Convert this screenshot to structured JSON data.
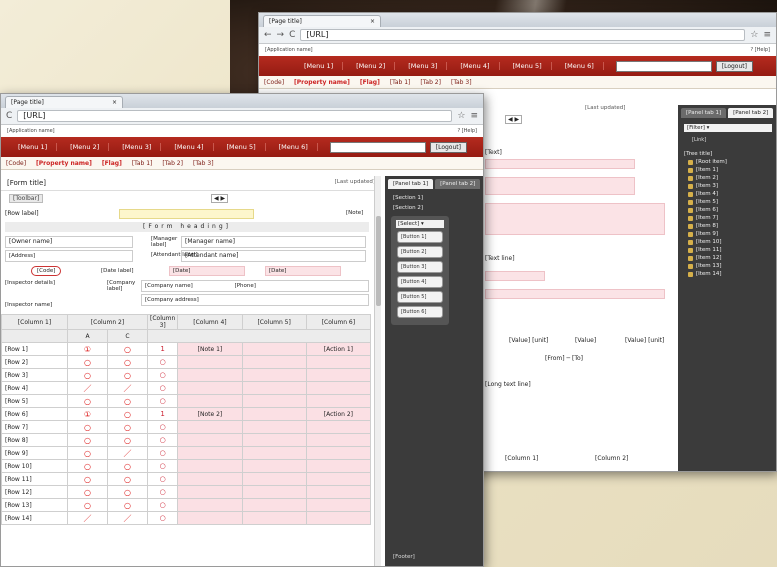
{
  "browser": {
    "tab_title": "[Page title]",
    "tab_close": "×",
    "url": "[URL]",
    "nav": {
      "back": "←",
      "forward": "→",
      "reload": "C"
    },
    "star": "☆",
    "menu": "≡"
  },
  "app": {
    "subtitle": "[Application name]",
    "help_label": "? [Help]",
    "menu_items": [
      "[Menu 1]",
      "[Menu 2]",
      "[Menu 3]",
      "[Menu 4]",
      "[Menu 5]",
      "[Menu 6]"
    ],
    "logout_label": "[Logout]",
    "property_code": "[Code]",
    "property_name": "[Property name]",
    "property_flag": "[Flag]",
    "prop_tabs": [
      "[Tab 1]",
      "[Tab 2]",
      "[Tab 3]"
    ]
  },
  "back_window": {
    "last_updated": "[Last updated]",
    "pager": "◀ ▶",
    "side_tabs": [
      "[Panel tab 1]",
      "[Panel tab 2]"
    ],
    "filter": "[Filter] ▾",
    "link": "[Link]",
    "tree_title": "[Tree title]",
    "tree_root": "[Root item]",
    "tree_items": [
      "[Item 1]",
      "[Item 2]",
      "[Item 3]",
      "[Item 4]",
      "[Item 5]",
      "[Item 6]",
      "[Item 7]",
      "[Item 8]",
      "[Item 9]",
      "[Item 10]",
      "[Item 11]",
      "[Item 12]",
      "[Item 13]",
      "[Item 14]"
    ],
    "text_line_1": "[Text]",
    "text_line_2": "[Text line]",
    "value_1": "[Value] [unit]",
    "value_2": "[Value]",
    "value_3": "[Value] [unit]",
    "from_to": "[From] ─ [To]",
    "long_text": "[Long text line]",
    "bottom_headers": [
      "[Column 1]",
      "[Column 2]"
    ]
  },
  "front_window": {
    "form_title": "[Form title]",
    "last_updated": "[Last updated]",
    "toolbar": "[Toolbar]",
    "pager": "◀ ▶",
    "row_label": "[Row label]",
    "header_banner": "[Form heading]",
    "note_right": "[Note]",
    "owner_name": "[Owner name]",
    "address": "[Address]",
    "manager_label": "[Manager label]",
    "manager_value": "[Manager name]",
    "attendant_label": "[Attendant label]",
    "attendant_value": "[Attendant name]",
    "code_badge": "[Code]",
    "date_label": "[Date label]",
    "date_from": "[Date]",
    "date_to": "[Date]",
    "company_label": "[Company label]",
    "company_name": "[Company name]",
    "tel": "[Phone]",
    "company_address": "[Company address]",
    "inspector_line": "[Inspector details]",
    "inspector_name": "[Inspector name]",
    "col_headers": [
      "[Column 1]",
      "[Column 2]",
      "[Column 3]",
      "[Column 4]",
      "[Column 5]",
      "[Column 6]"
    ],
    "sub_headers": [
      "A",
      "C"
    ],
    "rows": [
      {
        "label": "[Row 1]",
        "a": "①",
        "c": "○",
        "j": "1",
        "note": "[Note 1]",
        "action": "[Action 1]"
      },
      {
        "label": "[Row 2]",
        "a": "○",
        "c": "○",
        "j": "○",
        "note": "",
        "action": ""
      },
      {
        "label": "[Row 3]",
        "a": "○",
        "c": "○",
        "j": "○",
        "note": "",
        "action": ""
      },
      {
        "label": "[Row 4]",
        "a": "／",
        "c": "／",
        "j": "○",
        "note": "",
        "action": ""
      },
      {
        "label": "[Row 5]",
        "a": "○",
        "c": "○",
        "j": "○",
        "note": "",
        "action": ""
      },
      {
        "label": "[Row 6]",
        "a": "①",
        "c": "○",
        "j": "1",
        "note": "[Note 2]",
        "action": "[Action 2]"
      },
      {
        "label": "[Row 7]",
        "a": "○",
        "c": "○",
        "j": "○",
        "note": "",
        "action": ""
      },
      {
        "label": "[Row 8]",
        "a": "○",
        "c": "○",
        "j": "○",
        "note": "",
        "action": ""
      },
      {
        "label": "[Row 9]",
        "a": "○",
        "c": "／",
        "j": "○",
        "note": "",
        "action": ""
      },
      {
        "label": "[Row 10]",
        "a": "○",
        "c": "○",
        "j": "○",
        "note": "",
        "action": ""
      },
      {
        "label": "[Row 11]",
        "a": "○",
        "c": "○",
        "j": "○",
        "note": "",
        "action": ""
      },
      {
        "label": "[Row 12]",
        "a": "○",
        "c": "○",
        "j": "○",
        "note": "",
        "action": ""
      },
      {
        "label": "[Row 13]",
        "a": "○",
        "c": "○",
        "j": "○",
        "note": "",
        "action": ""
      },
      {
        "label": "[Row 14]",
        "a": "／",
        "c": "／",
        "j": "○",
        "note": "",
        "action": ""
      }
    ],
    "side_tabs": [
      "[Panel tab 1]",
      "[Panel tab 2]"
    ],
    "side_sections": [
      "[Section 1]",
      "[Section 2]"
    ],
    "side_select": "[Select] ▾",
    "side_buttons": [
      "[Button 1]",
      "[Button 2]",
      "[Button 3]",
      "[Button 4]",
      "[Button 5]",
      "[Button 6]"
    ],
    "side_footer": "[Footer]"
  },
  "colors": {
    "menu_red": "#a32217",
    "pink": "#fbe3e6",
    "yellow": "#fdf6cc",
    "side_dark": "#3b3b3b"
  }
}
